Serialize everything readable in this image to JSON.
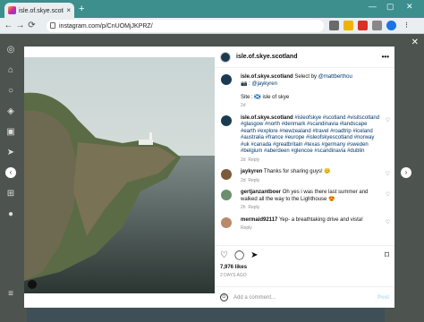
{
  "browser": {
    "tab_title": "isle.of.skye.scotland 🏴󠁧󠁢󠁳󠁣󠁴󠁿 (@isle.of...",
    "tab_close": "×",
    "new_tab": "+",
    "url": "instagram.com/p/CnUOMjJKPRZ/",
    "nav_back": "←",
    "nav_forward": "→",
    "nav_reload": "⟳",
    "win_min": "—",
    "win_max": "▢",
    "win_close": "✕"
  },
  "post": {
    "username": "isle.of.skye.scotland",
    "more": "•••",
    "caption_user": "isle.of.skye.scotland",
    "caption_text": "Select by",
    "caption_mention1": "@mattberthou",
    "caption_line2": "📷 :",
    "caption_mention2": "@jaykyren",
    "site_line": "Site : 🏴󠁧󠁢󠁳󠁣󠁴󠁿 isle of skye",
    "caption_age": "2d",
    "tags_user": "isle.of.skye.scotland",
    "hashtags": "#isleofskye #scotland #visitscotland #glasgow #north #denmark #scandinavia #landscape #earth #explore #newzealand #travel #roadtrip #iceland #australia #france #europe #isleofskyescotland #norway #uk #canada #greatbritain #texas #germany #sweden #belgium #aberdeen #glencoe #scandinavia #dublin",
    "tags_age": "2d",
    "tags_reply": "Reply",
    "comments": [
      {
        "user": "jaykyren",
        "text": "Thanks for sharing guys! 😊",
        "age": "2d",
        "reply": "Reply"
      },
      {
        "user": "gertjanzantboer",
        "text": "Oh yes i was there last summer and walked all the way to the Lighthouse 😍",
        "age": "2h",
        "reply": "Reply"
      },
      {
        "user": "mermaid92117",
        "text": "Yep- a breathtaking drive and vista!",
        "age": "",
        "reply": "Reply"
      }
    ],
    "likes": "7,976 likes",
    "post_age": "2 DAYS AGO",
    "add_comment_placeholder": "Add a comment...",
    "post_button": "Post"
  },
  "colors": {
    "titlebar": "#3d8f8e",
    "link": "#00376b",
    "backdrop": "#4c534e"
  },
  "icons": [
    "instagram-icon",
    "home-icon",
    "search-icon",
    "explore-icon",
    "reels-icon",
    "messages-icon",
    "notifications-icon",
    "create-icon",
    "profile-icon",
    "menu-icon",
    "heart-icon",
    "comment-icon",
    "share-icon",
    "bookmark-icon",
    "emoji-icon",
    "close-icon"
  ]
}
